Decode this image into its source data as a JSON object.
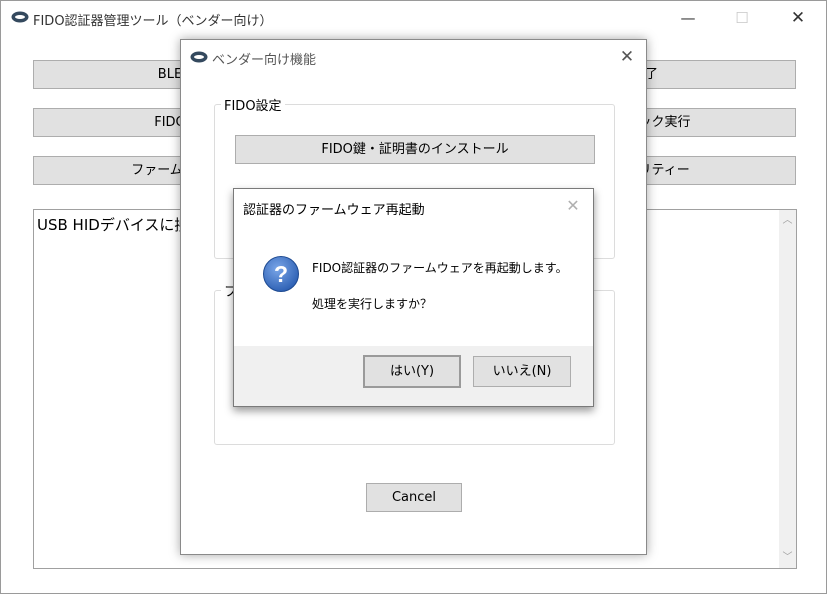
{
  "main_window": {
    "title": "FIDO認証器管理ツール（ベンダー向け）",
    "controls": {
      "minimize": "—",
      "maximize": "☐",
      "close": "✕"
    },
    "left_buttons": [
      {
        "label": "BLE設定"
      },
      {
        "label": "FIDO設定"
      },
      {
        "label": "ファームウェア更"
      }
    ],
    "right_buttons": [
      {
        "label": "終了"
      },
      {
        "label": "スチェック実行"
      },
      {
        "label": "ーティリティー"
      }
    ],
    "log_text": "USB HIDデバイスに接続"
  },
  "vendor_dialog": {
    "title": "ベンダー向け機能",
    "close": "✕",
    "fido_group_label": "FIDO設定",
    "install_button": "FIDO鍵・証明書のインストール",
    "firmware_group_label": "フ",
    "cancel_button": "Cancel"
  },
  "confirm_dialog": {
    "title": "認証器のファームウェア再起動",
    "close": "✕",
    "icon": "question-icon",
    "message_line1": "FIDO認証器のファームウェアを再起動します。",
    "message_line2": "処理を実行しますか？",
    "yes_button": "はい(Y)",
    "no_button": "いいえ(N)"
  },
  "colors": {
    "button_face": "#e1e1e1",
    "button_border": "#adadad",
    "dialog_footer": "#f0f0f0",
    "question_icon": "#2f62b5"
  }
}
